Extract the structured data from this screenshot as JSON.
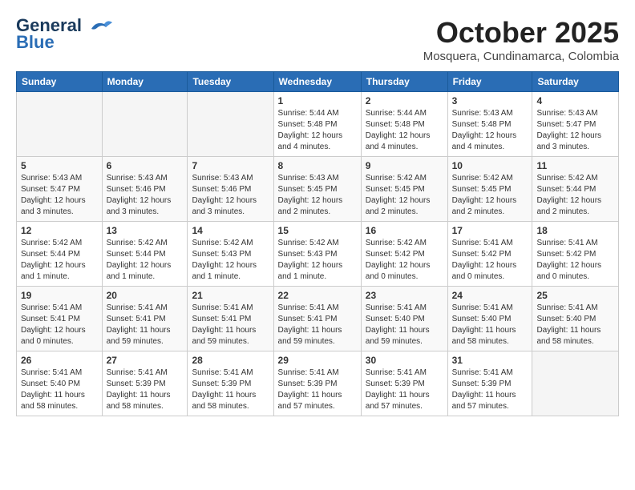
{
  "header": {
    "logo_line1": "General",
    "logo_line2": "Blue",
    "month": "October 2025",
    "location": "Mosquera, Cundinamarca, Colombia"
  },
  "days_of_week": [
    "Sunday",
    "Monday",
    "Tuesday",
    "Wednesday",
    "Thursday",
    "Friday",
    "Saturday"
  ],
  "weeks": [
    [
      {
        "day": "",
        "empty": true
      },
      {
        "day": "",
        "empty": true
      },
      {
        "day": "",
        "empty": true
      },
      {
        "day": "1",
        "sunrise": "Sunrise: 5:44 AM",
        "sunset": "Sunset: 5:48 PM",
        "daylight": "Daylight: 12 hours and 4 minutes."
      },
      {
        "day": "2",
        "sunrise": "Sunrise: 5:44 AM",
        "sunset": "Sunset: 5:48 PM",
        "daylight": "Daylight: 12 hours and 4 minutes."
      },
      {
        "day": "3",
        "sunrise": "Sunrise: 5:43 AM",
        "sunset": "Sunset: 5:48 PM",
        "daylight": "Daylight: 12 hours and 4 minutes."
      },
      {
        "day": "4",
        "sunrise": "Sunrise: 5:43 AM",
        "sunset": "Sunset: 5:47 PM",
        "daylight": "Daylight: 12 hours and 3 minutes."
      }
    ],
    [
      {
        "day": "5",
        "sunrise": "Sunrise: 5:43 AM",
        "sunset": "Sunset: 5:47 PM",
        "daylight": "Daylight: 12 hours and 3 minutes."
      },
      {
        "day": "6",
        "sunrise": "Sunrise: 5:43 AM",
        "sunset": "Sunset: 5:46 PM",
        "daylight": "Daylight: 12 hours and 3 minutes."
      },
      {
        "day": "7",
        "sunrise": "Sunrise: 5:43 AM",
        "sunset": "Sunset: 5:46 PM",
        "daylight": "Daylight: 12 hours and 3 minutes."
      },
      {
        "day": "8",
        "sunrise": "Sunrise: 5:43 AM",
        "sunset": "Sunset: 5:45 PM",
        "daylight": "Daylight: 12 hours and 2 minutes."
      },
      {
        "day": "9",
        "sunrise": "Sunrise: 5:42 AM",
        "sunset": "Sunset: 5:45 PM",
        "daylight": "Daylight: 12 hours and 2 minutes."
      },
      {
        "day": "10",
        "sunrise": "Sunrise: 5:42 AM",
        "sunset": "Sunset: 5:45 PM",
        "daylight": "Daylight: 12 hours and 2 minutes."
      },
      {
        "day": "11",
        "sunrise": "Sunrise: 5:42 AM",
        "sunset": "Sunset: 5:44 PM",
        "daylight": "Daylight: 12 hours and 2 minutes."
      }
    ],
    [
      {
        "day": "12",
        "sunrise": "Sunrise: 5:42 AM",
        "sunset": "Sunset: 5:44 PM",
        "daylight": "Daylight: 12 hours and 1 minute."
      },
      {
        "day": "13",
        "sunrise": "Sunrise: 5:42 AM",
        "sunset": "Sunset: 5:44 PM",
        "daylight": "Daylight: 12 hours and 1 minute."
      },
      {
        "day": "14",
        "sunrise": "Sunrise: 5:42 AM",
        "sunset": "Sunset: 5:43 PM",
        "daylight": "Daylight: 12 hours and 1 minute."
      },
      {
        "day": "15",
        "sunrise": "Sunrise: 5:42 AM",
        "sunset": "Sunset: 5:43 PM",
        "daylight": "Daylight: 12 hours and 1 minute."
      },
      {
        "day": "16",
        "sunrise": "Sunrise: 5:42 AM",
        "sunset": "Sunset: 5:42 PM",
        "daylight": "Daylight: 12 hours and 0 minutes."
      },
      {
        "day": "17",
        "sunrise": "Sunrise: 5:41 AM",
        "sunset": "Sunset: 5:42 PM",
        "daylight": "Daylight: 12 hours and 0 minutes."
      },
      {
        "day": "18",
        "sunrise": "Sunrise: 5:41 AM",
        "sunset": "Sunset: 5:42 PM",
        "daylight": "Daylight: 12 hours and 0 minutes."
      }
    ],
    [
      {
        "day": "19",
        "sunrise": "Sunrise: 5:41 AM",
        "sunset": "Sunset: 5:41 PM",
        "daylight": "Daylight: 12 hours and 0 minutes."
      },
      {
        "day": "20",
        "sunrise": "Sunrise: 5:41 AM",
        "sunset": "Sunset: 5:41 PM",
        "daylight": "Daylight: 11 hours and 59 minutes."
      },
      {
        "day": "21",
        "sunrise": "Sunrise: 5:41 AM",
        "sunset": "Sunset: 5:41 PM",
        "daylight": "Daylight: 11 hours and 59 minutes."
      },
      {
        "day": "22",
        "sunrise": "Sunrise: 5:41 AM",
        "sunset": "Sunset: 5:41 PM",
        "daylight": "Daylight: 11 hours and 59 minutes."
      },
      {
        "day": "23",
        "sunrise": "Sunrise: 5:41 AM",
        "sunset": "Sunset: 5:40 PM",
        "daylight": "Daylight: 11 hours and 59 minutes."
      },
      {
        "day": "24",
        "sunrise": "Sunrise: 5:41 AM",
        "sunset": "Sunset: 5:40 PM",
        "daylight": "Daylight: 11 hours and 58 minutes."
      },
      {
        "day": "25",
        "sunrise": "Sunrise: 5:41 AM",
        "sunset": "Sunset: 5:40 PM",
        "daylight": "Daylight: 11 hours and 58 minutes."
      }
    ],
    [
      {
        "day": "26",
        "sunrise": "Sunrise: 5:41 AM",
        "sunset": "Sunset: 5:40 PM",
        "daylight": "Daylight: 11 hours and 58 minutes."
      },
      {
        "day": "27",
        "sunrise": "Sunrise: 5:41 AM",
        "sunset": "Sunset: 5:39 PM",
        "daylight": "Daylight: 11 hours and 58 minutes."
      },
      {
        "day": "28",
        "sunrise": "Sunrise: 5:41 AM",
        "sunset": "Sunset: 5:39 PM",
        "daylight": "Daylight: 11 hours and 58 minutes."
      },
      {
        "day": "29",
        "sunrise": "Sunrise: 5:41 AM",
        "sunset": "Sunset: 5:39 PM",
        "daylight": "Daylight: 11 hours and 57 minutes."
      },
      {
        "day": "30",
        "sunrise": "Sunrise: 5:41 AM",
        "sunset": "Sunset: 5:39 PM",
        "daylight": "Daylight: 11 hours and 57 minutes."
      },
      {
        "day": "31",
        "sunrise": "Sunrise: 5:41 AM",
        "sunset": "Sunset: 5:39 PM",
        "daylight": "Daylight: 11 hours and 57 minutes."
      },
      {
        "day": "",
        "empty": true
      }
    ]
  ]
}
